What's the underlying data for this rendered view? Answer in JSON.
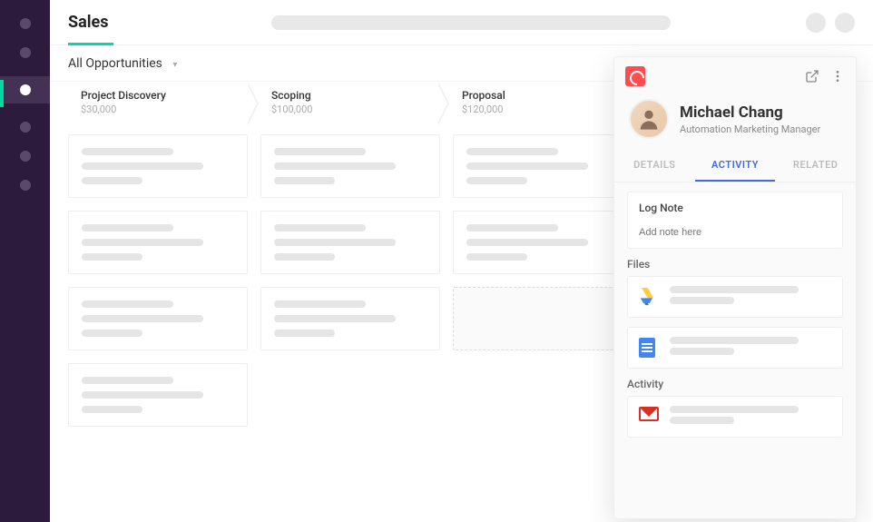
{
  "page": {
    "title": "Sales"
  },
  "filter": {
    "label": "All Opportunities"
  },
  "stages": [
    {
      "name": "Project Discovery",
      "value": "$30,000"
    },
    {
      "name": "Scoping",
      "value": "$100,000"
    },
    {
      "name": "Proposal",
      "value": "$120,000"
    }
  ],
  "drawer": {
    "contact": {
      "name": "Michael Chang",
      "title": "Automation Marketing Manager"
    },
    "tabs": {
      "details": "DETAILS",
      "activity": "ACTIVITY",
      "related": "RELATED"
    },
    "note": {
      "label": "Log Note",
      "placeholder": "Add note here"
    },
    "filesLabel": "Files",
    "activityLabel": "Activity"
  }
}
